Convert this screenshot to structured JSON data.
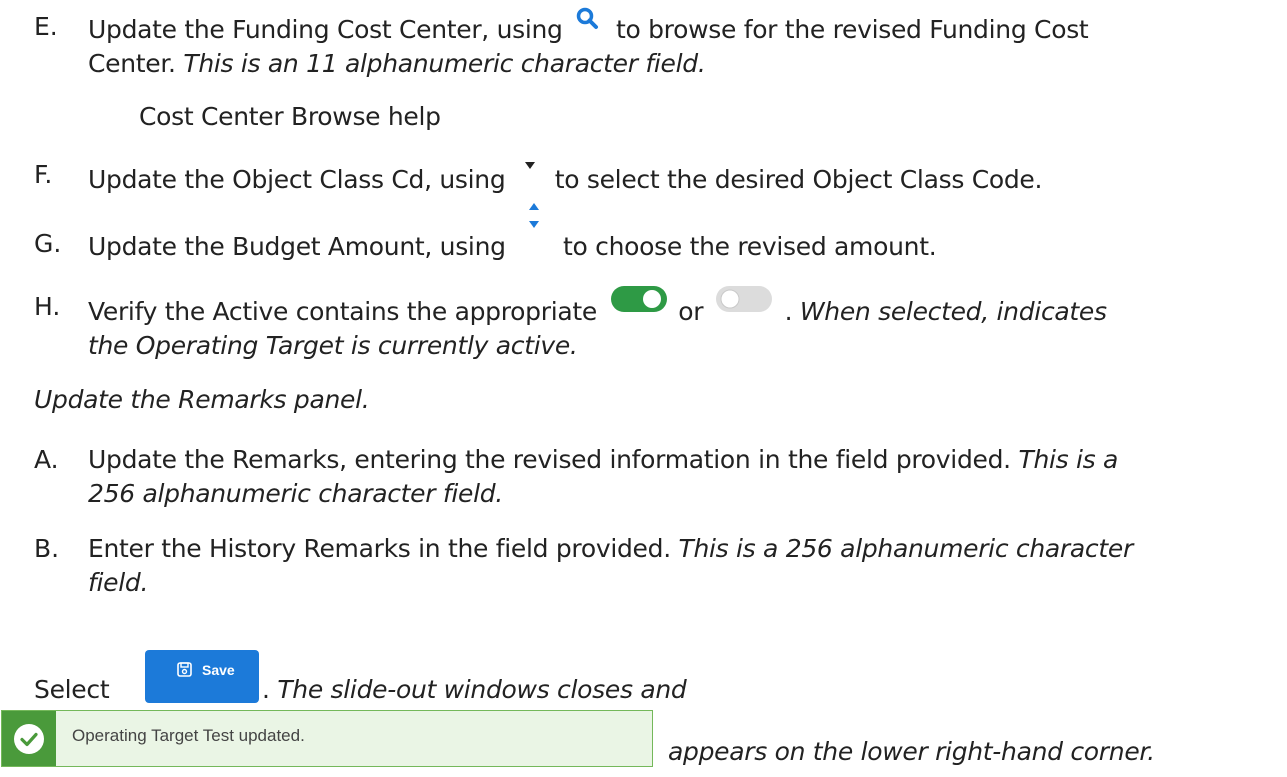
{
  "items": {
    "e": {
      "marker": "E.",
      "line1_pre": "Update the Funding Cost Center, using",
      "line1_post": "to browse for the revised Funding Cost",
      "line2_plain": "Center.",
      "line2_italic": "This is an 11 alphanumeric character field.",
      "help_link": "Cost Center Browse help",
      "icon": "search-icon"
    },
    "f": {
      "marker": "F.",
      "pre": "Update the Object Class Cd, using",
      "post": "to select the desired Object Class Code.",
      "icon": "dropdown-arrow-icon"
    },
    "g": {
      "marker": "G.",
      "pre": "Update the Budget Amount, using",
      "post": "to choose the revised amount.",
      "icon": "spinner-arrows-icon"
    },
    "h": {
      "marker": "H.",
      "pre": "Verify the Active contains the appropriate",
      "or": "or",
      "post_plain": ".",
      "post_italic": "When selected, indicates",
      "line2_italic": "the Operating Target is currently active.",
      "icon_on": "toggle-on-icon",
      "icon_off": "toggle-off-icon"
    }
  },
  "remarks_heading": "Update the Remarks panel.",
  "remarks_items": {
    "a": {
      "marker": "A.",
      "line1_plain": "Update the Remarks, entering the revised information in the field provided.",
      "line1_italic": "This is a",
      "line2_italic": "256 alphanumeric character field."
    },
    "b": {
      "marker": "B.",
      "line1_plain": "Enter the History Remarks in the field provided.",
      "line1_italic": "This is a 256 alphanumeric character",
      "line2_italic": "field."
    }
  },
  "final_step": {
    "select_label": "Select",
    "save_button_label": "Save",
    "post_plain": ".",
    "post_italic": "The slide-out windows closes and",
    "toast_message": "Operating Target Test updated.",
    "trailing_italic": "appears on the lower right-hand corner."
  },
  "colors": {
    "text": "#222222",
    "accent_blue": "#1c7ad9",
    "toggle_green": "#2e9a45",
    "toast_green": "#4a9a3b",
    "toast_bg": "#eaf5e5"
  }
}
